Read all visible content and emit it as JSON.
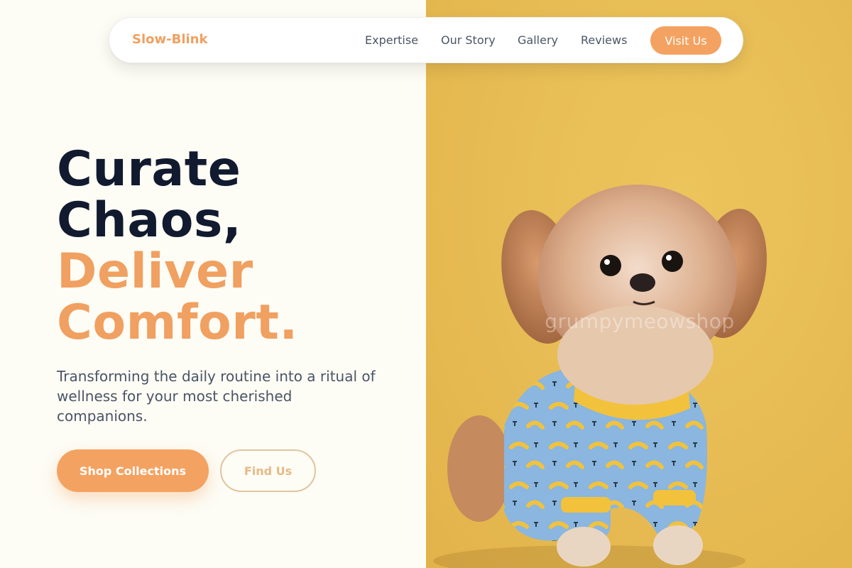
{
  "nav": {
    "brand": "Slow-Blink",
    "links": [
      "Expertise",
      "Our Story",
      "Gallery",
      "Reviews"
    ],
    "cta": "Visit Us"
  },
  "hero": {
    "headline_line1": "Curate",
    "headline_line2": "Chaos,",
    "headline_line3": "Deliver",
    "headline_line4": "Comfort.",
    "subtext": "Transforming the daily routine into a ritual of wellness for your most cherished companions.",
    "primary_button": "Shop Collections",
    "secondary_button": "Find Us",
    "image": {
      "subject": "small dog in banana-print pajamas on yellow background",
      "watermark": "grumpymeowshop"
    }
  },
  "colors": {
    "accent": "#f4a261",
    "accent_text": "#f0a060",
    "heading_dark": "#111a2e",
    "body_text": "#4a5565",
    "page_bg": "#fdfcf5",
    "photo_bg": "#e8bd55"
  }
}
